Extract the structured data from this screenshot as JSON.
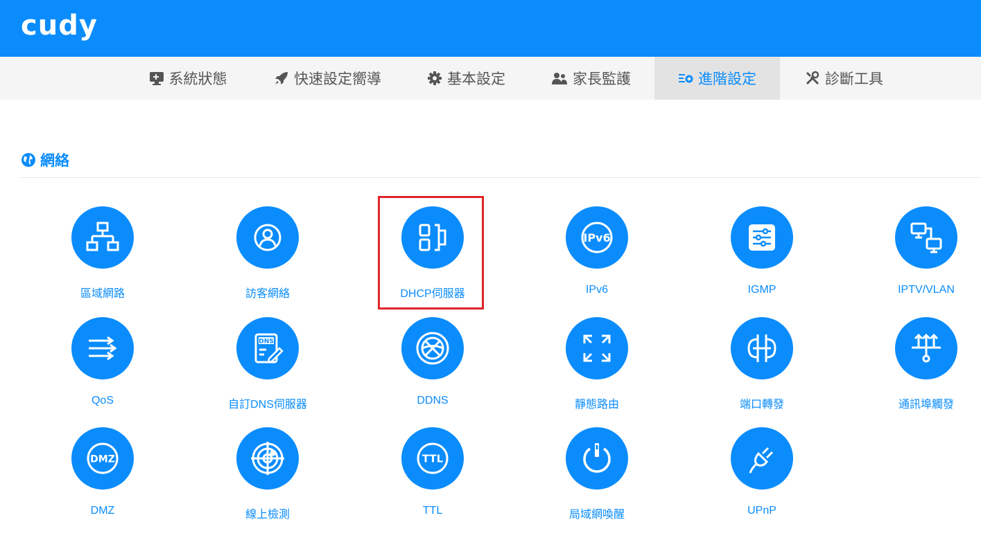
{
  "header": {
    "logo_text": "cudy",
    "brand_color": "#0a8cfc"
  },
  "nav": {
    "items": [
      {
        "label": "系統狀態",
        "icon": "monitor-icon"
      },
      {
        "label": "快速設定嚮導",
        "icon": "rocket-icon"
      },
      {
        "label": "基本設定",
        "icon": "gear-icon"
      },
      {
        "label": "家長監護",
        "icon": "users-icon"
      },
      {
        "label": "進階設定",
        "icon": "advanced-settings-icon",
        "active": true
      },
      {
        "label": "診斷工具",
        "icon": "tools-icon"
      }
    ]
  },
  "section": {
    "title": "網絡",
    "icon": "globe-icon"
  },
  "tiles": [
    {
      "label": "區域網路",
      "icon": "lan-topology-icon"
    },
    {
      "label": "訪客網絡",
      "icon": "guest-user-icon"
    },
    {
      "label": "DHCP伺服器",
      "icon": "dhcp-server-icon",
      "highlighted": true
    },
    {
      "label": "IPv6",
      "icon": "ipv6-icon",
      "icon_text": "IPv6"
    },
    {
      "label": "IGMP",
      "icon": "igmp-sliders-icon"
    },
    {
      "label": "IPTV/VLAN",
      "icon": "iptv-vlan-icon"
    },
    {
      "label": "QoS",
      "icon": "qos-arrows-icon"
    },
    {
      "label": "自訂DNS伺服器",
      "icon": "custom-dns-icon",
      "icon_text": "DNS"
    },
    {
      "label": "DDNS",
      "icon": "ddns-globe-icon"
    },
    {
      "label": "靜態路由",
      "icon": "static-route-icon"
    },
    {
      "label": "端口轉發",
      "icon": "port-forward-icon"
    },
    {
      "label": "通訊埠觸發",
      "icon": "port-trigger-icon"
    },
    {
      "label": "DMZ",
      "icon": "dmz-icon",
      "icon_text": "DMZ"
    },
    {
      "label": "線上檢測",
      "icon": "online-detect-icon"
    },
    {
      "label": "TTL",
      "icon": "ttl-icon",
      "icon_text": "TTL"
    },
    {
      "label": "局域網喚醒",
      "icon": "wake-on-lan-icon"
    },
    {
      "label": "UPnP",
      "icon": "upnp-plug-icon"
    }
  ]
}
